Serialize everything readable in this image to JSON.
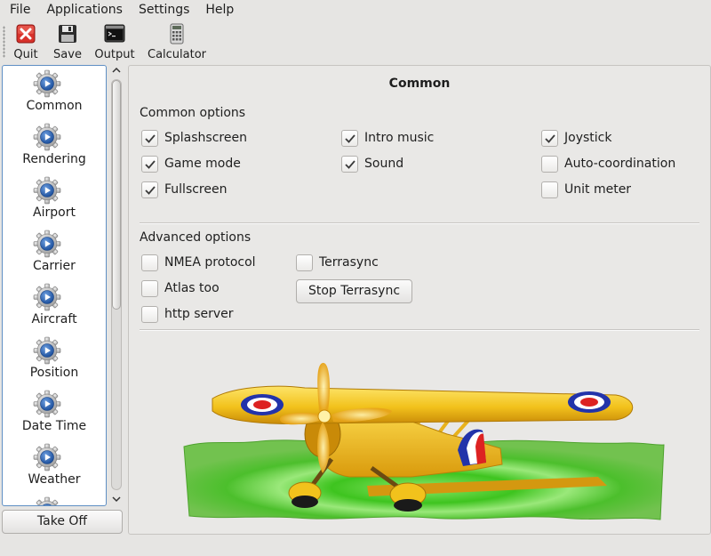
{
  "menubar": {
    "items": [
      {
        "label": "File"
      },
      {
        "label": "Applications"
      },
      {
        "label": "Settings"
      },
      {
        "label": "Help"
      }
    ]
  },
  "toolbar": {
    "quit_label": "Quit",
    "save_label": "Save",
    "output_label": "Output",
    "calculator_label": "Calculator"
  },
  "sidebar": {
    "items": [
      {
        "label": "Common",
        "icon": "gear-icon"
      },
      {
        "label": "Rendering",
        "icon": "gear-icon"
      },
      {
        "label": "Airport",
        "icon": "gear-icon"
      },
      {
        "label": "Carrier",
        "icon": "gear-icon"
      },
      {
        "label": "Aircraft",
        "icon": "gear-icon"
      },
      {
        "label": "Position",
        "icon": "gear-icon"
      },
      {
        "label": "Date Time",
        "icon": "gear-icon"
      },
      {
        "label": "Weather",
        "icon": "gear-icon"
      }
    ],
    "scroll_position": 0.0
  },
  "takeoff_button": {
    "label": "Take Off"
  },
  "panel": {
    "title": "Common",
    "common_options": {
      "title": "Common options",
      "checkboxes": [
        {
          "label": "Splashscreen",
          "checked": true
        },
        {
          "label": "Intro music",
          "checked": true
        },
        {
          "label": "Joystick",
          "checked": true
        },
        {
          "label": "Game mode",
          "checked": true
        },
        {
          "label": "Sound",
          "checked": true
        },
        {
          "label": "Auto-coordination",
          "checked": false
        },
        {
          "label": "Fullscreen",
          "checked": true
        },
        {
          "label": "Unit meter",
          "checked": false
        }
      ]
    },
    "advanced_options": {
      "title": "Advanced options",
      "checkboxes": [
        {
          "label": "NMEA protocol",
          "checked": false
        },
        {
          "label": "Terrasync",
          "checked": false
        },
        {
          "label": "Atlas too",
          "checked": false
        },
        {
          "label": "http server",
          "checked": false
        }
      ],
      "stop_terrasync_label": "Stop Terrasync"
    }
  },
  "colors": {
    "selection_border": "#5f8fc4",
    "plane_yellow": "#f2c21c",
    "grass_green": "#5cc23a",
    "roundel_blue": "#2233aa",
    "roundel_red": "#dd2222"
  }
}
